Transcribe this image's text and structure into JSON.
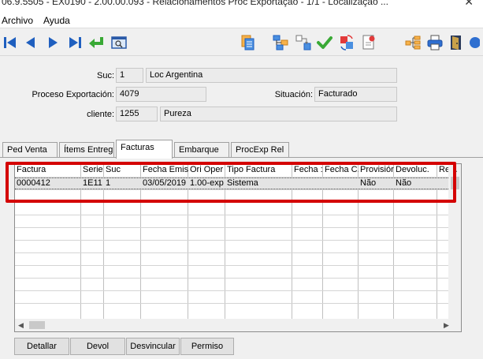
{
  "window": {
    "title": "06.9.5505 - EX0190 - 2.00.00.093 - Relacionamentos Proc Exportação - 1/1 - Localização ..."
  },
  "menu": [
    "Archivo",
    "Ayuda"
  ],
  "header": {
    "suc_label": "Suc:",
    "suc_code": "1",
    "suc_name": "Loc Argentina",
    "proceso_label": "Proceso Exportación:",
    "proceso_value": "4079",
    "situacion_label": "Situación:",
    "situacion_value": "Facturado",
    "cliente_label": "cliente:",
    "cliente_code": "1255",
    "cliente_name": "Pureza"
  },
  "tabs": [
    "Ped Venta",
    "Ítems Entreg",
    "Facturas",
    "Embarque",
    "ProcExp Rel"
  ],
  "active_tab": "Facturas",
  "grid": {
    "columns": [
      "Factura",
      "Serie",
      "Suc",
      "Fecha Emis",
      "Ori Oper",
      "Tipo Factura",
      "Fecha :",
      "Fecha C.",
      "Provisiór",
      "Devoluc.",
      "Re"
    ],
    "rows": [
      [
        "0000412",
        "1E11",
        "1",
        "03/05/2019",
        "1.00-exp",
        "Sistema",
        "",
        "",
        "Não",
        "Não",
        ""
      ]
    ]
  },
  "buttons": [
    "Detallar",
    "Devol",
    "Desvincular",
    "Permiso"
  ],
  "colors": {
    "highlight": "#d40000",
    "nav_blue": "#1f5fbf",
    "check_green": "#39a935"
  }
}
